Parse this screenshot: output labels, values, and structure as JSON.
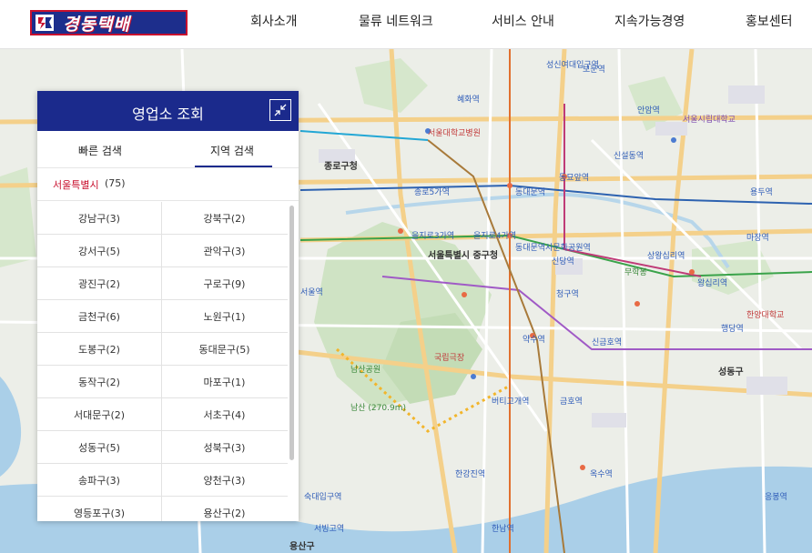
{
  "header": {
    "logo_text": "경동택배",
    "nav": [
      "회사소개",
      "물류 네트워크",
      "서비스 안내",
      "지속가능경영",
      "홍보센터"
    ]
  },
  "panel": {
    "title": "영업소 조회",
    "collapse_icon": "collapse-arrows-icon",
    "tabs": [
      {
        "label": "빠른 검색",
        "active": false
      },
      {
        "label": "지역 검색",
        "active": true
      }
    ],
    "region": {
      "name": "서울특별시",
      "count": "(75)"
    },
    "districts": [
      [
        "강남구(3)",
        "강북구(2)"
      ],
      [
        "강서구(5)",
        "관악구(3)"
      ],
      [
        "광진구(2)",
        "구로구(9)"
      ],
      [
        "금천구(6)",
        "노원구(1)"
      ],
      [
        "도봉구(2)",
        "동대문구(5)"
      ],
      [
        "동작구(2)",
        "마포구(1)"
      ],
      [
        "서대문구(2)",
        "서초구(4)"
      ],
      [
        "성동구(5)",
        "성북구(3)"
      ],
      [
        "송파구(3)",
        "양천구(3)"
      ],
      [
        "영등포구(3)",
        "용산구(2)"
      ]
    ]
  },
  "map": {
    "labels": [
      "서울특별시 중구청",
      "종로구청",
      "동대문역",
      "동대문역사문화공원역",
      "남산공원",
      "남산 (270.9m)",
      "국립극장",
      "약수역",
      "신당역",
      "청구역",
      "신금호역",
      "옥수역",
      "한강진역",
      "숙대입구역",
      "서울역",
      "을지로3가역",
      "을지로4가역",
      "종로5가역",
      "혜화역",
      "성신여대입구역",
      "안암역",
      "보문역",
      "동묘앞역",
      "신설동역",
      "용두역",
      "왕십리역",
      "마장역",
      "상왕십리역",
      "행당역",
      "응봉역",
      "금호역",
      "버티고개역",
      "한남역",
      "서빙고역",
      "성동구",
      "용산구",
      "서울대학교병원",
      "서울시립대학교",
      "무학봉",
      "한양대학교"
    ]
  }
}
